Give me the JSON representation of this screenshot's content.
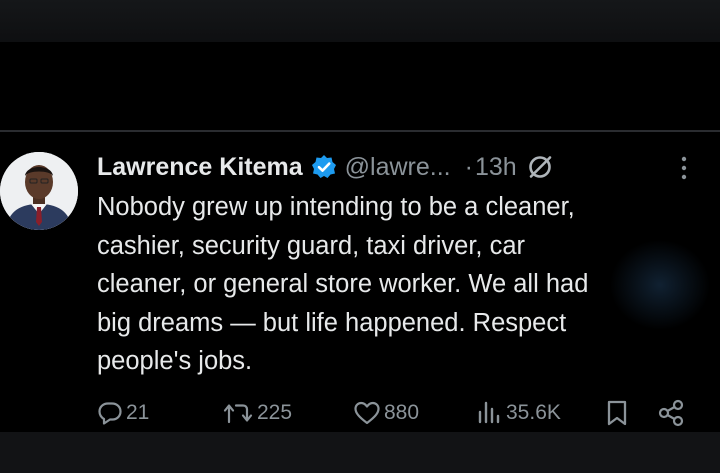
{
  "tweet": {
    "author_name": "Lawrence Kitema",
    "handle": "@lawre...",
    "dot": "·",
    "time": "13h",
    "text_lines": [
      "Nobody grew up intending to be a cleaner,",
      "cashier, security guard, taxi driver, car",
      "cleaner, or general store worker. We all had",
      "big dreams — but life happened. Respect",
      "people's jobs."
    ]
  },
  "stats": {
    "replies": "21",
    "reposts": "225",
    "likes": "880",
    "views": "35.6K"
  },
  "colors": {
    "background": "#000000",
    "text": "#e7e9ea",
    "secondary": "#8b9399",
    "verified": "#1d9bf0"
  },
  "icons": {
    "verified": "verified-badge-icon",
    "grok": "grok-icon",
    "more": "more-dots-icon",
    "reply": "reply-icon",
    "repost": "repost-icon",
    "like": "like-icon",
    "views": "views-icon",
    "bookmark": "bookmark-icon",
    "share": "share-icon"
  }
}
